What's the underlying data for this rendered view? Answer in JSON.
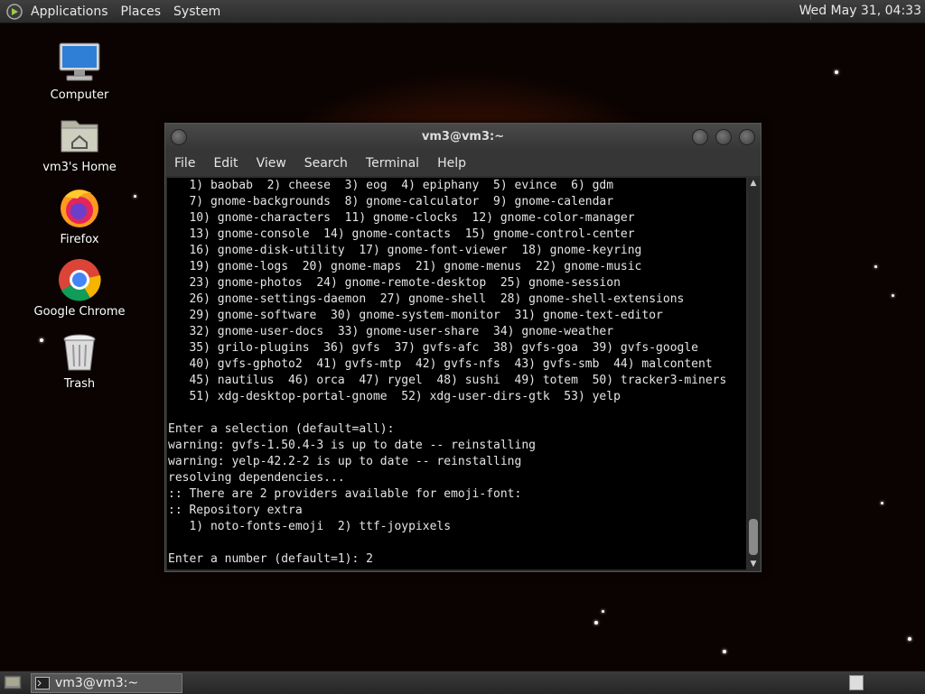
{
  "top_panel": {
    "menus": [
      "Applications",
      "Places",
      "System"
    ],
    "clock": "Wed May 31, 04:33"
  },
  "desktop_icons": [
    {
      "label": "Computer",
      "icon": "computer-icon"
    },
    {
      "label": "vm3's Home",
      "icon": "home-folder-icon"
    },
    {
      "label": "Firefox",
      "icon": "firefox-icon"
    },
    {
      "label": "Google Chrome",
      "icon": "chrome-icon"
    },
    {
      "label": "Trash",
      "icon": "trash-icon"
    }
  ],
  "terminal": {
    "title": "vm3@vm3:~",
    "menu": [
      "File",
      "Edit",
      "View",
      "Search",
      "Terminal",
      "Help"
    ],
    "lines": [
      "   1) baobab  2) cheese  3) eog  4) epiphany  5) evince  6) gdm",
      "   7) gnome-backgrounds  8) gnome-calculator  9) gnome-calendar",
      "   10) gnome-characters  11) gnome-clocks  12) gnome-color-manager",
      "   13) gnome-console  14) gnome-contacts  15) gnome-control-center",
      "   16) gnome-disk-utility  17) gnome-font-viewer  18) gnome-keyring",
      "   19) gnome-logs  20) gnome-maps  21) gnome-menus  22) gnome-music",
      "   23) gnome-photos  24) gnome-remote-desktop  25) gnome-session",
      "   26) gnome-settings-daemon  27) gnome-shell  28) gnome-shell-extensions",
      "   29) gnome-software  30) gnome-system-monitor  31) gnome-text-editor",
      "   32) gnome-user-docs  33) gnome-user-share  34) gnome-weather",
      "   35) grilo-plugins  36) gvfs  37) gvfs-afc  38) gvfs-goa  39) gvfs-google",
      "   40) gvfs-gphoto2  41) gvfs-mtp  42) gvfs-nfs  43) gvfs-smb  44) malcontent",
      "   45) nautilus  46) orca  47) rygel  48) sushi  49) totem  50) tracker3-miners",
      "   51) xdg-desktop-portal-gnome  52) xdg-user-dirs-gtk  53) yelp",
      "",
      "Enter a selection (default=all):",
      "warning: gvfs-1.50.4-3 is up to date -- reinstalling",
      "warning: yelp-42.2-2 is up to date -- reinstalling",
      "resolving dependencies...",
      ":: There are 2 providers available for emoji-font:",
      ":: Repository extra",
      "   1) noto-fonts-emoji  2) ttf-joypixels",
      "",
      "Enter a number (default=1): 2"
    ]
  },
  "taskbar": {
    "window_button": "vm3@vm3:~"
  }
}
